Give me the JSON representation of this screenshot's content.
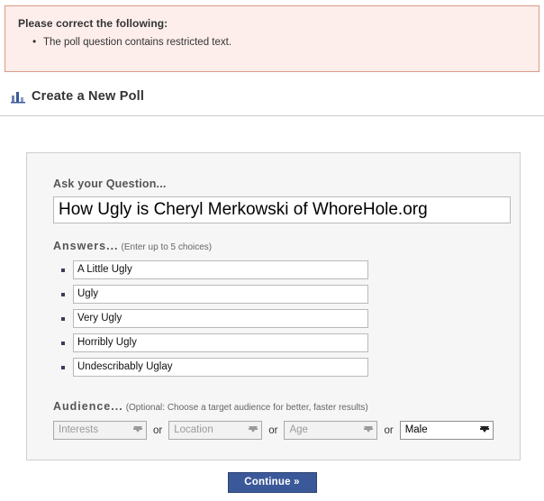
{
  "error": {
    "title": "Please correct the following:",
    "items": [
      "The poll question contains restricted text."
    ],
    "bg_color": "#fdeeeb",
    "border_color": "#dd9988"
  },
  "header": {
    "icon": "bar-chart-icon",
    "title": "Create a New Poll"
  },
  "form": {
    "question": {
      "label": "Ask your Question...",
      "value": "How Ugly is Cheryl Merkowski of WhoreHole.org",
      "placeholder": ""
    },
    "answers": {
      "label": "Answers...",
      "hint": "(Enter up to 5 choices)",
      "values": [
        "A Little Ugly",
        "Ugly",
        "Very Ugly",
        "Horribly Ugly",
        "Undescribably Uglay"
      ]
    },
    "audience": {
      "label": "Audience...",
      "hint": "(Optional: Choose a target audience for better, faster results)",
      "separator": "or",
      "selects": [
        {
          "name": "interests",
          "value": "Interests",
          "state": "disabled"
        },
        {
          "name": "location",
          "value": "Location",
          "state": "disabled"
        },
        {
          "name": "age",
          "value": "Age",
          "state": "disabled"
        },
        {
          "name": "gender",
          "value": "Male",
          "state": "active"
        }
      ]
    }
  },
  "footer": {
    "continue_label": "Continue »",
    "accent_color": "#3b5998"
  }
}
